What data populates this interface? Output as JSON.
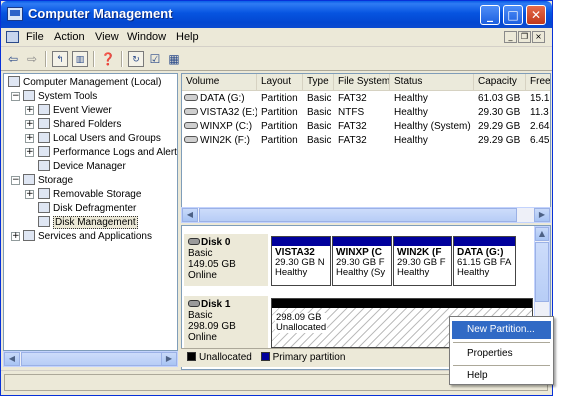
{
  "window": {
    "title": "Computer Management"
  },
  "menu": {
    "items": [
      "File",
      "Action",
      "View",
      "Window",
      "Help"
    ]
  },
  "tree": {
    "items": [
      {
        "label": "Computer Management (Local)",
        "icon": "computer-icon",
        "expander": ""
      },
      {
        "label": "System Tools",
        "icon": "tools-icon",
        "expander": "−"
      },
      {
        "label": "Event Viewer",
        "icon": "event-viewer-icon",
        "expander": "+"
      },
      {
        "label": "Shared Folders",
        "icon": "shared-folders-icon",
        "expander": "+"
      },
      {
        "label": "Local Users and Groups",
        "icon": "users-icon",
        "expander": "+"
      },
      {
        "label": "Performance Logs and Alerts",
        "icon": "performance-icon",
        "expander": "+"
      },
      {
        "label": "Device Manager",
        "icon": "device-manager-icon",
        "expander": ""
      },
      {
        "label": "Storage",
        "icon": "storage-icon",
        "expander": "−"
      },
      {
        "label": "Removable Storage",
        "icon": "removable-storage-icon",
        "expander": "+"
      },
      {
        "label": "Disk Defragmenter",
        "icon": "defragmenter-icon",
        "expander": ""
      },
      {
        "label": "Disk Management",
        "icon": "disk-management-icon",
        "expander": ""
      },
      {
        "label": "Services and Applications",
        "icon": "services-icon",
        "expander": "+"
      }
    ]
  },
  "volumes": {
    "columns": [
      "Volume",
      "Layout",
      "Type",
      "File System",
      "Status",
      "Capacity",
      "Free"
    ],
    "rows": [
      [
        "DATA (G:)",
        "Partition",
        "Basic",
        "FAT32",
        "Healthy",
        "61.03 GB",
        "15.1"
      ],
      [
        "VISTA32 (E:)",
        "Partition",
        "Basic",
        "NTFS",
        "Healthy",
        "29.30 GB",
        "11.3"
      ],
      [
        "WINXP (C:)",
        "Partition",
        "Basic",
        "FAT32",
        "Healthy (System)",
        "29.29 GB",
        "2.64"
      ],
      [
        "WIN2K (F:)",
        "Partition",
        "Basic",
        "FAT32",
        "Healthy",
        "29.29 GB",
        "6.45"
      ]
    ]
  },
  "disks": [
    {
      "name": "Disk 0",
      "type": "Basic",
      "size": "149.05 GB",
      "status": "Online",
      "partitions": [
        {
          "name": "VISTA32",
          "detail": "29.30 GB N",
          "status": "Healthy"
        },
        {
          "name": "WINXP  (C",
          "detail": "29.30 GB F",
          "status": "Healthy (Sy"
        },
        {
          "name": "WIN2K  (F",
          "detail": "29.30 GB F",
          "status": "Healthy"
        },
        {
          "name": "DATA  (G:)",
          "detail": "61.15 GB FA",
          "status": "Healthy"
        }
      ]
    },
    {
      "name": "Disk 1",
      "type": "Basic",
      "size": "298.09 GB",
      "status": "Online",
      "partitions": [
        {
          "name": "",
          "detail": "298.09 GB",
          "status": "Unallocated"
        }
      ]
    }
  ],
  "legend": {
    "unallocated": "Unallocated",
    "primary": "Primary partition"
  },
  "context_menu": {
    "items": [
      "New Partition...",
      "Properties",
      "Help"
    ]
  },
  "colors": {
    "title_bar": "#0654e0",
    "primary_partition": "#00009c",
    "unallocated": "#000000",
    "highlight": "#316ac5"
  }
}
